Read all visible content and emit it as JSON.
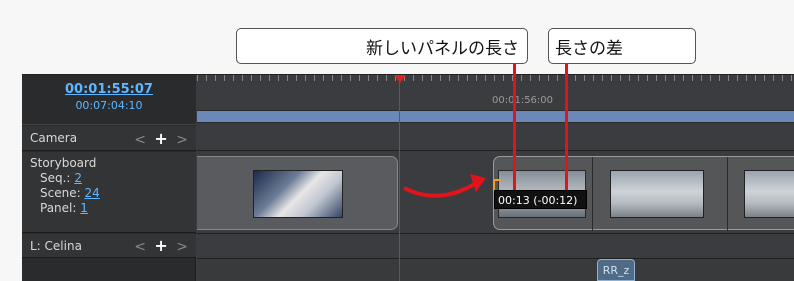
{
  "callouts": {
    "new_panel_length": "新しいパネルの長さ",
    "length_difference": "長さの差"
  },
  "timeline": {
    "current_timecode": "00:01:55:07",
    "total_duration": "00:07:04:10",
    "ruler_label": "00:01:56:00",
    "tracks": {
      "camera": "Camera",
      "storyboard": "Storyboard",
      "celina": "L: Celina"
    },
    "storyboard_info": {
      "seq_label": "Seq.:",
      "seq_value": "2",
      "scene_label": "Scene:",
      "scene_value": "24",
      "panel_label": "Panel:",
      "panel_value": "1"
    },
    "nav_prev": "<",
    "nav_add": "+",
    "nav_next": ">",
    "tooltip": "00:13 (-00:12)",
    "tag": "RR_z"
  },
  "colors": {
    "accent_red": "#e0141b",
    "timecode_blue": "#5fb7ff",
    "track_bg": "#3a3c3f"
  }
}
